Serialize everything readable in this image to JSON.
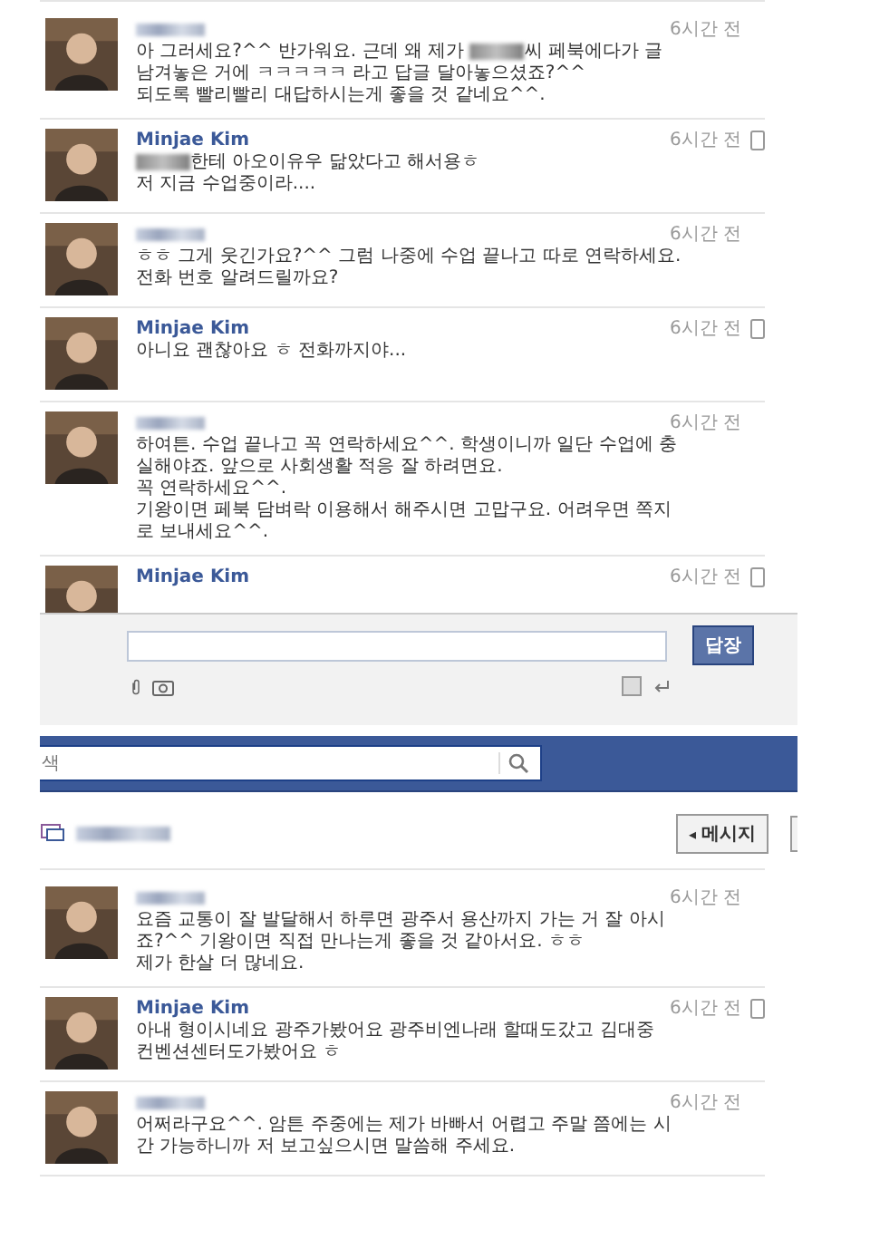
{
  "thread": [
    {
      "author": {
        "kind": "blurred"
      },
      "time": "6시간 전",
      "mobile": false,
      "lines": [
        {
          "segments": [
            {
              "kind": "text",
              "text": "아 그러세요?^^ 반가워요. 근데 왜 제가 "
            },
            {
              "kind": "blur"
            },
            {
              "kind": "text",
              "text": "씨 페북에다가 글"
            }
          ]
        },
        "남겨놓은 거에 ㅋㅋㅋㅋㅋ 라고 답글 달아놓으셨죠?^^",
        "되도록 빨리빨리 대답하시는게 좋을 것 같네요^^."
      ]
    },
    {
      "author": {
        "kind": "named",
        "name": "Minjae Kim"
      },
      "time": "6시간 전",
      "mobile": true,
      "lines": [
        {
          "segments": [
            {
              "kind": "blur"
            },
            {
              "kind": "text",
              "text": "한테 아오이유우 닮았다고 해서용ㅎ"
            }
          ]
        },
        "저 지금 수업중이라...."
      ]
    },
    {
      "author": {
        "kind": "blurred"
      },
      "time": "6시간 전",
      "mobile": false,
      "lines": [
        "ㅎㅎ 그게 웃긴가요?^^ 그럼 나중에 수업 끝나고 따로 연락하세요.",
        "전화 번호 알려드릴까요?"
      ]
    },
    {
      "author": {
        "kind": "named",
        "name": "Minjae Kim"
      },
      "time": "6시간 전",
      "mobile": true,
      "lines": [
        "아니요 괜찮아요 ㅎ 전화까지야..."
      ]
    },
    {
      "author": {
        "kind": "blurred"
      },
      "time": "6시간 전",
      "mobile": false,
      "lines": [
        "하여튼. 수업 끝나고 꼭 연락하세요^^. 학생이니까 일단 수업에 충",
        "실해야죠. 앞으로 사회생활 적응 잘 하려면요.",
        "꼭 연락하세요^^.",
        "기왕이면 페북 담벼락 이용해서 해주시면 고맙구요. 어려우면 쪽지",
        "로 보내세요^^."
      ]
    },
    {
      "author": {
        "kind": "named",
        "name": "Minjae Kim"
      },
      "time": "6시간 전",
      "mobile": true
    }
  ],
  "reply": {
    "button": "답장",
    "enter_sends": false
  },
  "topbar": {
    "search_placeholder": "색"
  },
  "header": {
    "back_button": {
      "arrow": "◂",
      "label": "메시지"
    }
  },
  "thread2": [
    {
      "author": {
        "kind": "blurred"
      },
      "time": "6시간 전",
      "mobile": false,
      "lines": [
        "요즘 교통이 잘 발달해서 하루면 광주서 용산까지 가는 거 잘 아시",
        "죠?^^ 기왕이면 직접 만나는게 좋을 것 같아서요. ㅎㅎ",
        "제가 한살 더 많네요."
      ]
    },
    {
      "author": {
        "kind": "named",
        "name": "Minjae Kim"
      },
      "time": "6시간 전",
      "mobile": true,
      "lines": [
        "아내 형이시네요 광주가봤어요 광주비엔나래 할때도갔고 김대중",
        "컨벤션센터도가봤어요 ㅎ"
      ]
    },
    {
      "author": {
        "kind": "blurred"
      },
      "time": "6시간 전",
      "mobile": false,
      "lines": [
        "어쩌라구요^^. 암튼 주중에는 제가 바빠서 어렵고 주말 쯤에는 시",
        "간 가능하니까 저 보고싶으시면 말씀해 주세요."
      ]
    }
  ]
}
